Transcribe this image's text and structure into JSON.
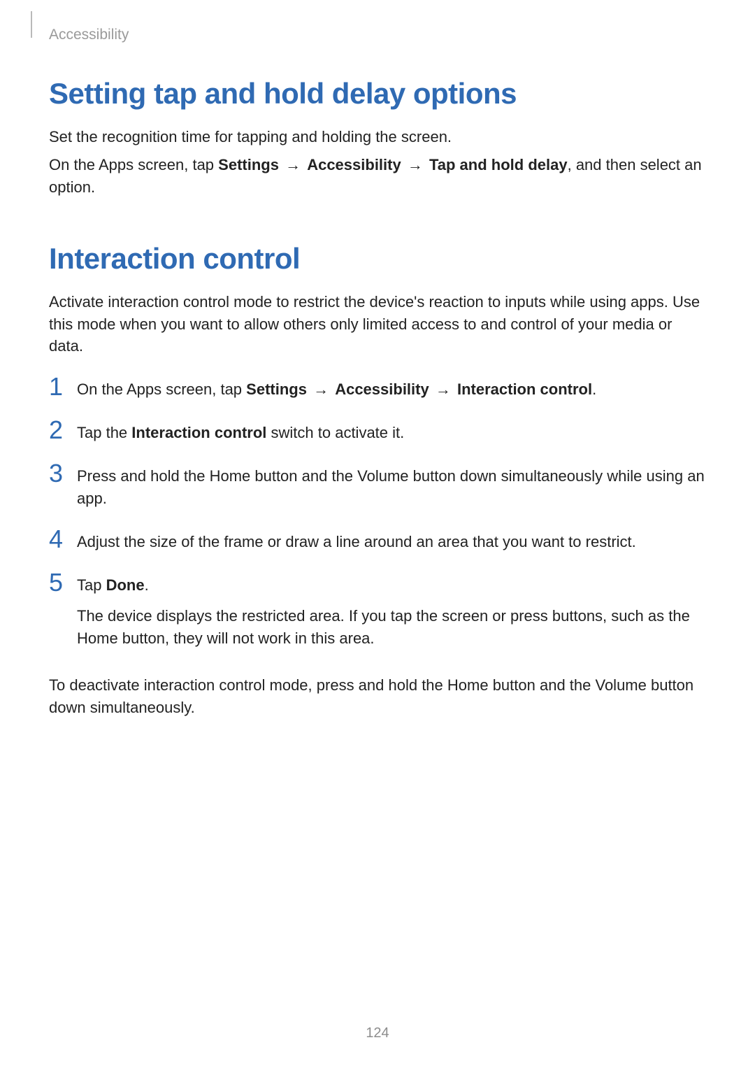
{
  "header": {
    "section": "Accessibility"
  },
  "section1": {
    "title": "Setting tap and hold delay options",
    "p1": "Set the recognition time for tapping and holding the screen.",
    "p2_pre": "On the Apps screen, tap ",
    "settings": "Settings",
    "arrow": "→",
    "accessibility": "Accessibility",
    "taphold": "Tap and hold delay",
    "p2_post": ", and then select an option."
  },
  "section2": {
    "title": "Interaction control",
    "intro": "Activate interaction control mode to restrict the device's reaction to inputs while using apps. Use this mode when you want to allow others only limited access to and control of your media or data.",
    "steps": {
      "1": {
        "num": "1",
        "pre": "On the Apps screen, tap ",
        "settings": "Settings",
        "arrow": "→",
        "accessibility": "Accessibility",
        "interaction": "Interaction control",
        "post": "."
      },
      "2": {
        "num": "2",
        "pre": "Tap the ",
        "bold": "Interaction control",
        "post": " switch to activate it."
      },
      "3": {
        "num": "3",
        "text": "Press and hold the Home button and the Volume button down simultaneously while using an app."
      },
      "4": {
        "num": "4",
        "text": "Adjust the size of the frame or draw a line around an area that you want to restrict."
      },
      "5": {
        "num": "5",
        "pre": "Tap ",
        "bold": "Done",
        "post": ".",
        "note": "The device displays the restricted area. If you tap the screen or press buttons, such as the Home button, they will not work in this area."
      }
    },
    "outro": "To deactivate interaction control mode, press and hold the Home button and the Volume button down simultaneously."
  },
  "page_number": "124"
}
